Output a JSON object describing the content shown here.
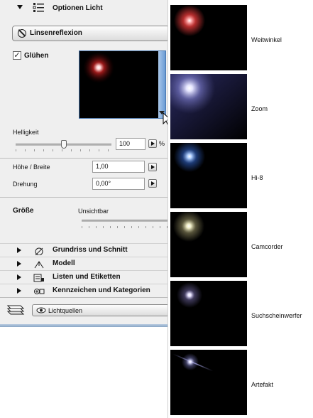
{
  "header": {
    "title": "Optionen Licht"
  },
  "lens_flare_button": {
    "label": "Linsenreflexion"
  },
  "glow": {
    "label": "Glühen",
    "checked": true,
    "check_glyph": "✓"
  },
  "brightness": {
    "label": "Helligkeit",
    "value": "100",
    "unit": "%",
    "fraction": 0.5
  },
  "height_width": {
    "label": "Höhe / Breite",
    "value": "1,00"
  },
  "rotation": {
    "label": "Drehung",
    "value": "0,00°"
  },
  "size": {
    "label": "Größe",
    "value_label": "Unsichtbar"
  },
  "sections": [
    {
      "label": "Grundriss und Schnitt",
      "icon": "floor-plan-icon"
    },
    {
      "label": "Modell",
      "icon": "model-icon"
    },
    {
      "label": "Listen und Etiketten",
      "icon": "list-label-icon"
    },
    {
      "label": "Kennzeichen und Kategorien",
      "icon": "tag-category-icon"
    }
  ],
  "footer": {
    "lights_label": "Lichtquellen"
  },
  "flare_presets": [
    {
      "label": "Weitwinkel",
      "color": "#ff4040"
    },
    {
      "label": "Zoom",
      "color": "#c8c8ff"
    },
    {
      "label": "Hi-8",
      "color": "#6aa8ff"
    },
    {
      "label": "Camcorder",
      "color": "#e8e6b0"
    },
    {
      "label": "Suchscheinwerfer",
      "color": "#e6e2ff"
    },
    {
      "label": "Artefakt",
      "color": "#d8d8ff"
    }
  ]
}
